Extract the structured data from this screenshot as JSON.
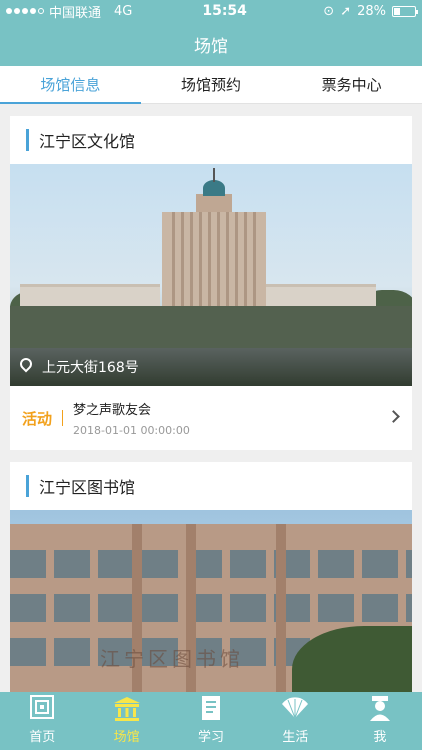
{
  "status_bar": {
    "carrier": "中国联通",
    "network": "4G",
    "time": "15:54",
    "battery": "28%"
  },
  "nav": {
    "title": "场馆"
  },
  "tabs": [
    {
      "label": "场馆信息",
      "active": true
    },
    {
      "label": "场馆预约",
      "active": false
    },
    {
      "label": "票务中心",
      "active": false
    }
  ],
  "venues": [
    {
      "name": "江宁区文化馆",
      "address": "上元大街168号",
      "activity": {
        "tag": "活动",
        "name": "梦之声歌友会",
        "datetime": "2018-01-01 00:00:00"
      }
    },
    {
      "name": "江宁区图书馆",
      "sign_text": "江宁区图书馆"
    }
  ],
  "tabbar": [
    {
      "label": "首页",
      "icon": "home-icon",
      "active": false
    },
    {
      "label": "场馆",
      "icon": "venue-icon",
      "active": true
    },
    {
      "label": "学习",
      "icon": "study-icon",
      "active": false
    },
    {
      "label": "生活",
      "icon": "life-fan-icon",
      "active": false
    },
    {
      "label": "我",
      "icon": "profile-icon",
      "active": false
    }
  ],
  "colors": {
    "brand": "#78c2c4",
    "accent": "#4aa3d8",
    "activity": "#f2a11c",
    "tab_active": "#f7e64a"
  }
}
